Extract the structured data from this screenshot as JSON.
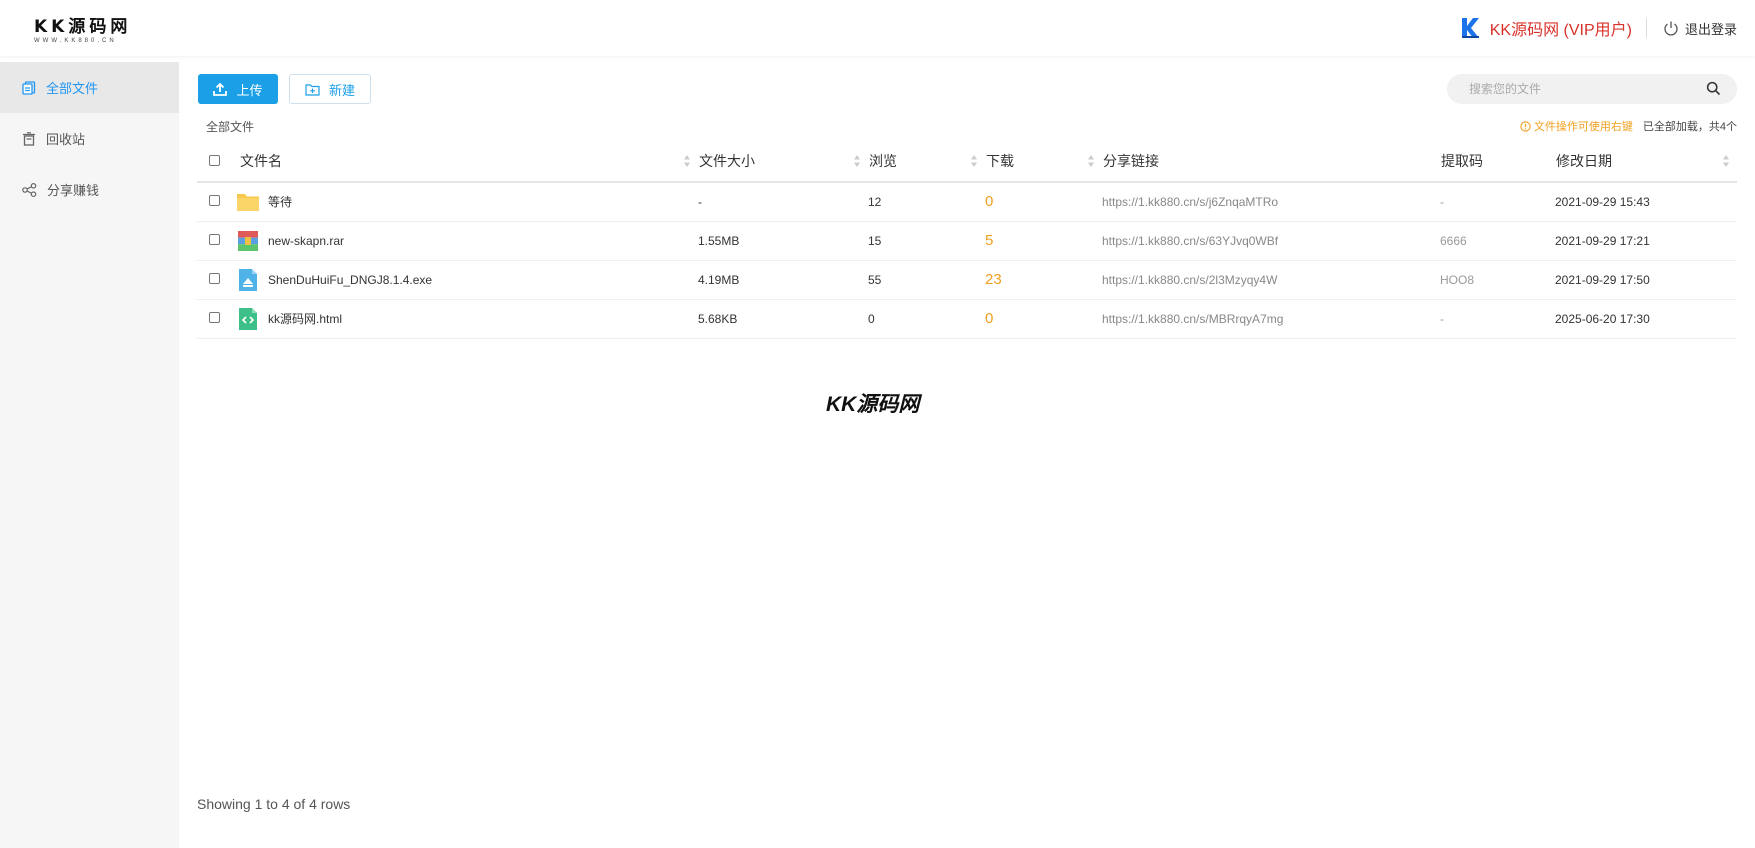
{
  "header": {
    "logo_title": "KK源码网",
    "logo_sub": "WWW.KK880.CN",
    "user_name": "KK源码网 (VIP用户)",
    "logout_label": "退出登录"
  },
  "sidebar": {
    "items": [
      {
        "label": "全部文件",
        "icon": "files-icon",
        "active": true
      },
      {
        "label": "回收站",
        "icon": "recycle-bin-icon",
        "active": false
      },
      {
        "label": "分享赚钱",
        "icon": "share-icon",
        "active": false
      }
    ]
  },
  "toolbar": {
    "upload_label": "上传",
    "new_label": "新建",
    "search_placeholder": "搜索您的文件"
  },
  "breadcrumb": "全部文件",
  "hint": {
    "warn": "文件操作可使用右键",
    "count": "已全部加载，共4个"
  },
  "table": {
    "columns": [
      "文件名",
      "文件大小",
      "浏览",
      "下载",
      "分享链接",
      "提取码",
      "修改日期"
    ],
    "rows": [
      {
        "name": "等待",
        "type": "folder",
        "size": "-",
        "views": "12",
        "downloads": "0",
        "link": "https://1.kk880.cn/s/j6ZnqaMTRo",
        "code": "-",
        "date": "2021-09-29 15:43"
      },
      {
        "name": "new-skapn.rar",
        "type": "archive",
        "size": "1.55MB",
        "views": "15",
        "downloads": "5",
        "link": "https://1.kk880.cn/s/63YJvq0WBf",
        "code": "6666",
        "date": "2021-09-29 17:21"
      },
      {
        "name": "ShenDuHuiFu_DNGJ8.1.4.exe",
        "type": "exe",
        "size": "4.19MB",
        "views": "55",
        "downloads": "23",
        "link": "https://1.kk880.cn/s/2l3Mzyqy4W",
        "code": "HOO8",
        "date": "2021-09-29 17:50"
      },
      {
        "name": "kk源码网.html",
        "type": "html",
        "size": "5.68KB",
        "views": "0",
        "downloads": "0",
        "link": "https://1.kk880.cn/s/MBRrqyA7mg",
        "code": "-",
        "date": "2025-06-20 17:30"
      }
    ]
  },
  "watermark": "KK源码网",
  "footer": "Showing 1 to 4 of 4 rows",
  "colors": {
    "accent": "#1ba0e8",
    "vip_red": "#d9322c",
    "download_orange": "#f0a020"
  }
}
